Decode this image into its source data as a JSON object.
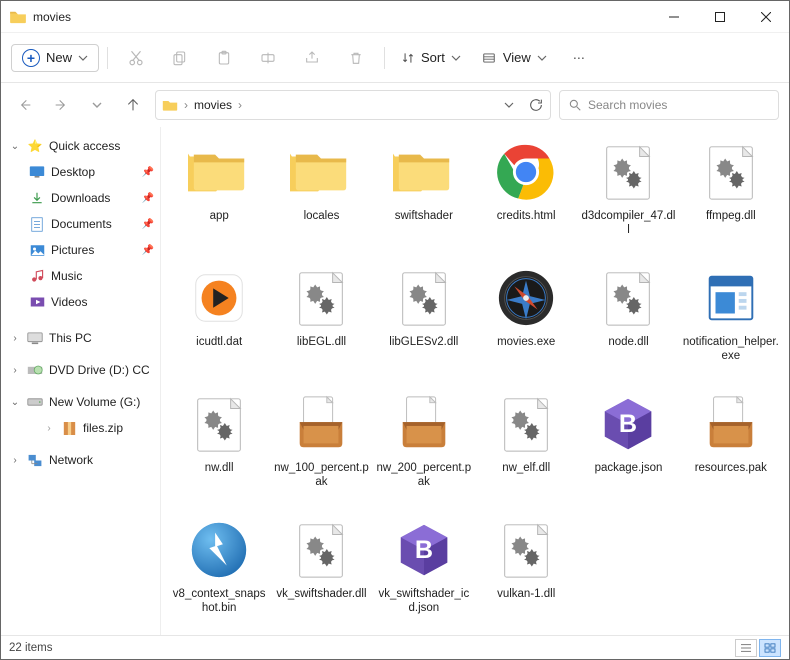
{
  "window": {
    "title": "movies"
  },
  "toolbar": {
    "new_label": "New",
    "sort_label": "Sort",
    "view_label": "View"
  },
  "address": {
    "crumb1": "movies",
    "search_placeholder": "Search movies"
  },
  "sidebar": {
    "quick_access": "Quick access",
    "desktop": "Desktop",
    "downloads": "Downloads",
    "documents": "Documents",
    "pictures": "Pictures",
    "music": "Music",
    "videos": "Videos",
    "this_pc": "This PC",
    "dvd": "DVD Drive (D:) CCCC",
    "new_volume": "New Volume (G:)",
    "files_zip": "files.zip",
    "network": "Network"
  },
  "files": [
    {
      "name": "app",
      "type": "folder"
    },
    {
      "name": "locales",
      "type": "folder"
    },
    {
      "name": "swiftshader",
      "type": "folder"
    },
    {
      "name": "credits.html",
      "type": "chrome"
    },
    {
      "name": "d3dcompiler_47.dll",
      "type": "dll"
    },
    {
      "name": "ffmpeg.dll",
      "type": "dll"
    },
    {
      "name": "icudtl.dat",
      "type": "vlc"
    },
    {
      "name": "libEGL.dll",
      "type": "dll"
    },
    {
      "name": "libGLESv2.dll",
      "type": "dll"
    },
    {
      "name": "movies.exe",
      "type": "compass"
    },
    {
      "name": "node.dll",
      "type": "dll"
    },
    {
      "name": "notification_helper.exe",
      "type": "exe"
    },
    {
      "name": "nw.dll",
      "type": "dll"
    },
    {
      "name": "nw_100_percent.pak",
      "type": "pak"
    },
    {
      "name": "nw_200_percent.pak",
      "type": "pak"
    },
    {
      "name": "nw_elf.dll",
      "type": "dll"
    },
    {
      "name": "package.json",
      "type": "bbedit"
    },
    {
      "name": "resources.pak",
      "type": "pak"
    },
    {
      "name": "v8_context_snapshot.bin",
      "type": "daemon"
    },
    {
      "name": "vk_swiftshader.dll",
      "type": "dll"
    },
    {
      "name": "vk_swiftshader_icd.json",
      "type": "bbedit"
    },
    {
      "name": "vulkan-1.dll",
      "type": "dll"
    }
  ],
  "status": {
    "count": "22 items"
  }
}
